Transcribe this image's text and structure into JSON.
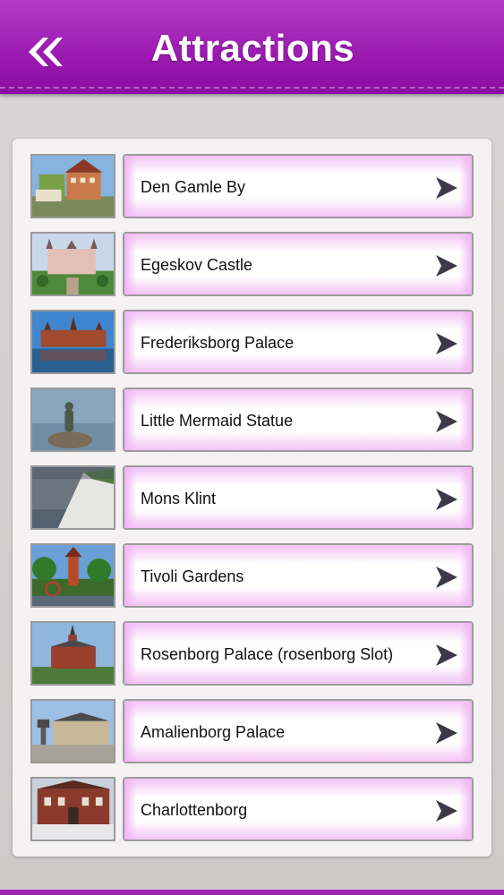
{
  "header": {
    "title": "Attractions",
    "back_icon": "double-chevron-left-icon",
    "color": "#9a1ab0"
  },
  "attractions": [
    {
      "name": "Den Gamle By",
      "thumb": "old-town-houses"
    },
    {
      "name": "Egeskov Castle",
      "thumb": "castle-gardens"
    },
    {
      "name": "Frederiksborg Palace",
      "thumb": "palace-lake"
    },
    {
      "name": "Little Mermaid Statue",
      "thumb": "mermaid-statue"
    },
    {
      "name": "Mons Klint",
      "thumb": "chalk-cliffs"
    },
    {
      "name": "Tivoli Gardens",
      "thumb": "amusement-park"
    },
    {
      "name": "Rosenborg Palace (rosenborg Slot)",
      "thumb": "palace-spires"
    },
    {
      "name": "Amalienborg Palace",
      "thumb": "palace-square"
    },
    {
      "name": "Charlottenborg",
      "thumb": "brick-building"
    }
  ],
  "row_arrow_icon": "chevron-right-icon"
}
